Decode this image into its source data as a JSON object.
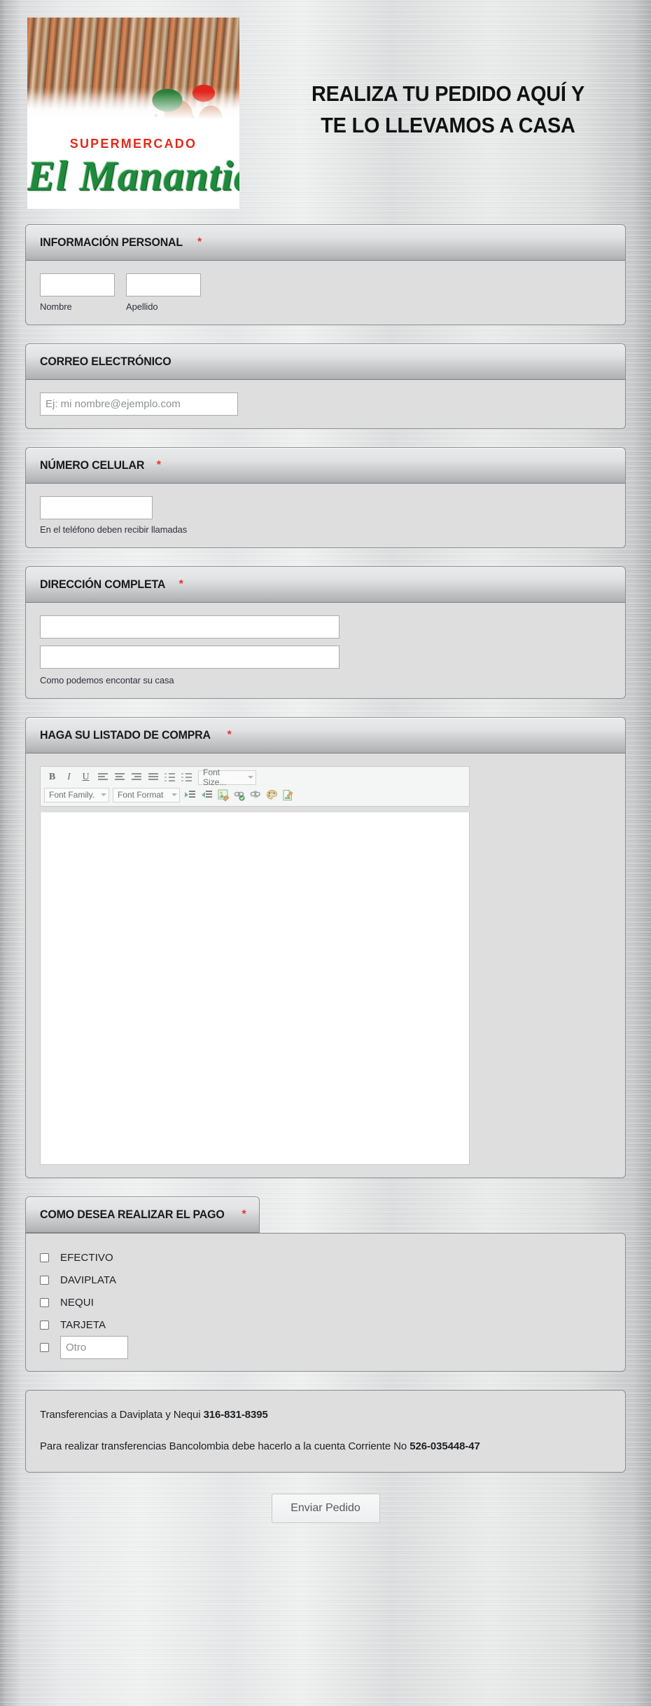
{
  "header": {
    "logo": {
      "supermercado_label": "SUPERMERCADO",
      "store_name": "El Manantial",
      "alt": "logo-supermercado-el-manantial"
    },
    "title_line1": "REALIZA TU PEDIDO AQUÍ Y",
    "title_line2": "TE LO LLEVAMOS A CASA"
  },
  "sections": {
    "personal": {
      "title": "INFORMACIÓN PERSONAL",
      "required_mark": "*",
      "nombre_label": "Nombre",
      "apellido_label": "Apellido",
      "nombre_value": "",
      "apellido_value": ""
    },
    "email": {
      "title": "CORREO ELECTRÓNICO",
      "placeholder": "Ej: mi nombre@ejemplo.com",
      "value": ""
    },
    "phone": {
      "title": "NÚMERO CELULAR",
      "required_mark": "*",
      "hint": "En el teléfono deben recibir llamadas",
      "value": ""
    },
    "address": {
      "title": "DIRECCIÓN COMPLETA",
      "required_mark": "*",
      "hint": "Como podemos encontar su casa",
      "line1_value": "",
      "line2_value": ""
    },
    "shopping_list": {
      "title": "HAGA SU LISTADO DE COMPRA",
      "required_mark": "*",
      "editor_value": "",
      "toolbar": {
        "bold": "B",
        "italic": "I",
        "underline": "U",
        "align_left": "align-left-icon",
        "align_center": "align-center-icon",
        "align_right": "align-right-icon",
        "align_justify": "align-justify-icon",
        "ordered_list": "ordered-list-icon",
        "unordered_list": "unordered-list-icon",
        "font_size": "Font Size...",
        "font_family": "Font Family.",
        "font_format": "Font Format",
        "indent": "indent-icon",
        "outdent": "outdent-icon",
        "edit_image": "edit-image-icon",
        "insert_link": "insert-link-icon",
        "remove_link": "remove-link-icon",
        "text_color": "color-palette-icon",
        "source_code": "source-code-icon"
      }
    },
    "payment": {
      "title": "COMO DESEA REALIZAR EL PAGO",
      "required_mark": "*",
      "options": [
        {
          "label": "EFECTIVO",
          "checked": false
        },
        {
          "label": "DAVIPLATA",
          "checked": false
        },
        {
          "label": "NEQUI",
          "checked": false
        },
        {
          "label": "TARJETA",
          "checked": false
        }
      ],
      "other": {
        "checked": false,
        "placeholder": "Otro",
        "value": ""
      }
    }
  },
  "info_panel": {
    "line1_text": "Transferencias a Daviplata y Nequi ",
    "line1_number": "316-831-8395",
    "line2_text": "Para realizar transferencias Bancolombia debe hacerlo a la cuenta Corriente No ",
    "line2_number": "526-035448-47"
  },
  "submit": {
    "label": "Enviar Pedido"
  },
  "colors": {
    "required_red": "#e8332a",
    "logo_green": "#1f8a3b",
    "logo_red": "#e02b1c",
    "section_body_bg": "#dededf",
    "page_bg": "#c9cacb"
  }
}
